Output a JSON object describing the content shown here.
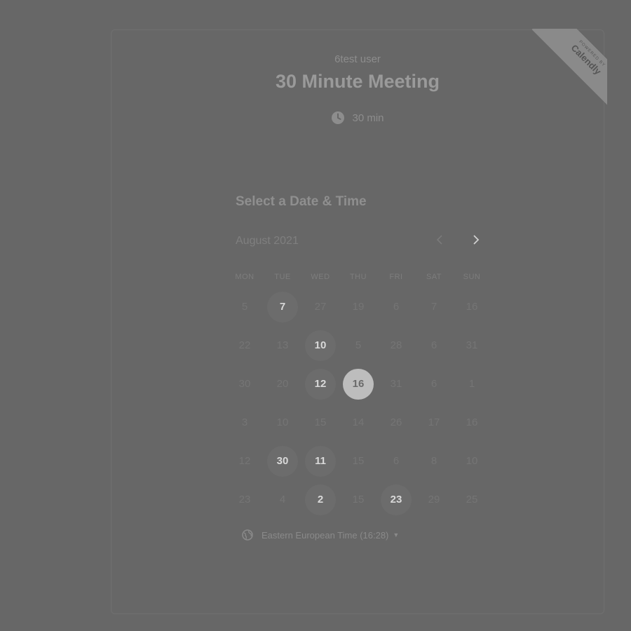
{
  "branding": {
    "powered_by": "POWERED BY",
    "brand": "Calendly"
  },
  "event": {
    "owner": "6test user",
    "title": "30 Minute Meeting",
    "duration": "30 min"
  },
  "calendar": {
    "section_title": "Select a Date & Time",
    "month_label": "August 2021",
    "weekdays": [
      "MON",
      "TUE",
      "WED",
      "THU",
      "FRI",
      "SAT",
      "SUN"
    ],
    "weeks": [
      [
        {
          "d": "5"
        },
        {
          "d": "7",
          "available": true
        },
        {
          "d": "27"
        },
        {
          "d": "19"
        },
        {
          "d": "6"
        },
        {
          "d": "7"
        },
        {
          "d": "16"
        }
      ],
      [
        {
          "d": "22"
        },
        {
          "d": "13"
        },
        {
          "d": "10",
          "available": true
        },
        {
          "d": "5"
        },
        {
          "d": "28"
        },
        {
          "d": "6"
        },
        {
          "d": "31"
        }
      ],
      [
        {
          "d": "30"
        },
        {
          "d": "20"
        },
        {
          "d": "12",
          "available": true
        },
        {
          "d": "16",
          "selected": true
        },
        {
          "d": "31"
        },
        {
          "d": "6"
        },
        {
          "d": "1"
        }
      ],
      [
        {
          "d": "3"
        },
        {
          "d": "10"
        },
        {
          "d": "15"
        },
        {
          "d": "14"
        },
        {
          "d": "26"
        },
        {
          "d": "17"
        },
        {
          "d": "16"
        }
      ],
      [
        {
          "d": "12"
        },
        {
          "d": "30",
          "available": true
        },
        {
          "d": "11",
          "available": true
        },
        {
          "d": "15"
        },
        {
          "d": "6"
        },
        {
          "d": "8"
        },
        {
          "d": "10"
        }
      ],
      [
        {
          "d": "23"
        },
        {
          "d": "4"
        },
        {
          "d": "2",
          "available": true
        },
        {
          "d": "15"
        },
        {
          "d": "23",
          "available": true
        },
        {
          "d": "29"
        },
        {
          "d": "25"
        }
      ]
    ]
  },
  "timezone": {
    "label": "Eastern European Time (16:28)"
  },
  "colors": {
    "overlay": "#676767",
    "selected": "#bdbdbd"
  }
}
